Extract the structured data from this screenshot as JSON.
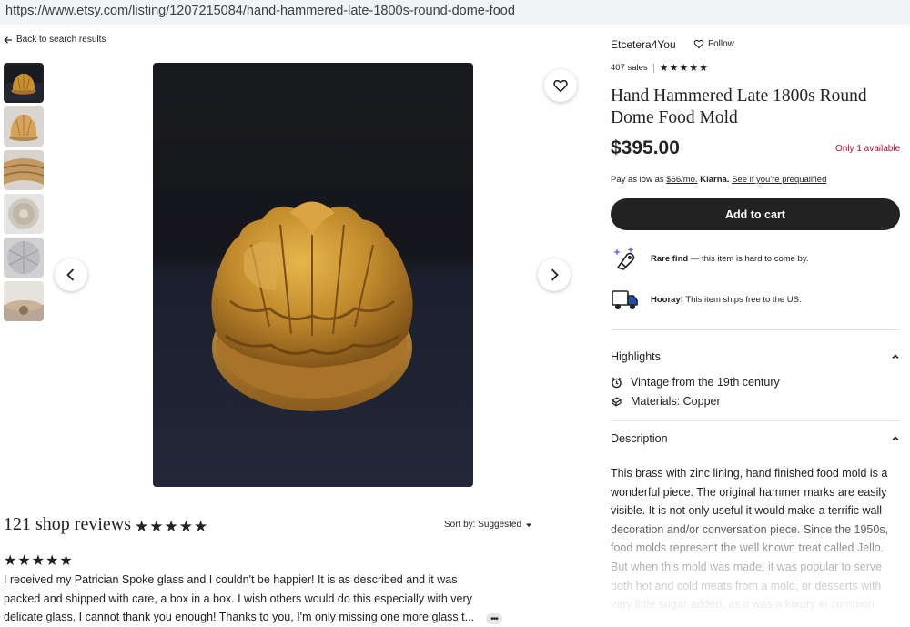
{
  "browser": {
    "url": "https://www.etsy.com/listing/1207215084/hand-hammered-late-1800s-round-dome-food"
  },
  "nav": {
    "back_label": "Back to search results"
  },
  "gallery": {
    "thumbnail_count": 6,
    "selected_index": 0
  },
  "shop": {
    "name": "Etcetera4You",
    "follow_label": "Follow",
    "sales": "407 sales",
    "rating_stars": "★★★★★"
  },
  "listing": {
    "title": "Hand Hammered Late 1800s Round Dome Food Mold",
    "price": "$395.00",
    "availability": "Only 1 available",
    "pay_prefix": "Pay as low as ",
    "pay_amount": "$66/mo.",
    "pay_provider": "Klarna.",
    "pay_link": "See if you're prequalified",
    "add_to_cart": "Add to cart"
  },
  "badges": {
    "rare_bold": "Rare find",
    "rare_text": " — this item is hard to come by.",
    "shipping_bold": "Hooray!",
    "shipping_text": " This item ships free to the US."
  },
  "highlights": {
    "heading": "Highlights",
    "items": [
      {
        "icon": "vintage-icon",
        "label": "Vintage from the 19th century"
      },
      {
        "icon": "materials-icon",
        "label": "Materials: Copper"
      }
    ]
  },
  "description": {
    "heading": "Description",
    "text": "This brass with zinc lining, hand finished food mold is a wonderful piece. The original hammer marks are easily visible. It is not only useful it would make a terrific wall decoration and/or conversation piece. Since the 1950s, food molds represent the well known treat called Jello. But when this mold was made, it was popular to serve both hot and cold meats from a mold, or desserts with very little sugar added, as it was a luxury in common"
  },
  "reviews": {
    "title": "121 shop reviews",
    "stars": "★★★★★",
    "sort_label": "Sort by: Suggested",
    "review_stars": "★★★★★",
    "review_text": "I received my Patrician Spoke glass and I couldn't be happier! It is as described and it was packed and shipped with care, a box in a box. I wish others would do this especially with very delicate glass. I cannot thank you enough! Thanks to you, I'm only missing one more glass t...",
    "more_label": "•••"
  },
  "colors": {
    "accent": "#222222",
    "availability": "#a61a2e",
    "rare_icon": "#7b61ff",
    "truck_icon": "#1e4fb4"
  }
}
